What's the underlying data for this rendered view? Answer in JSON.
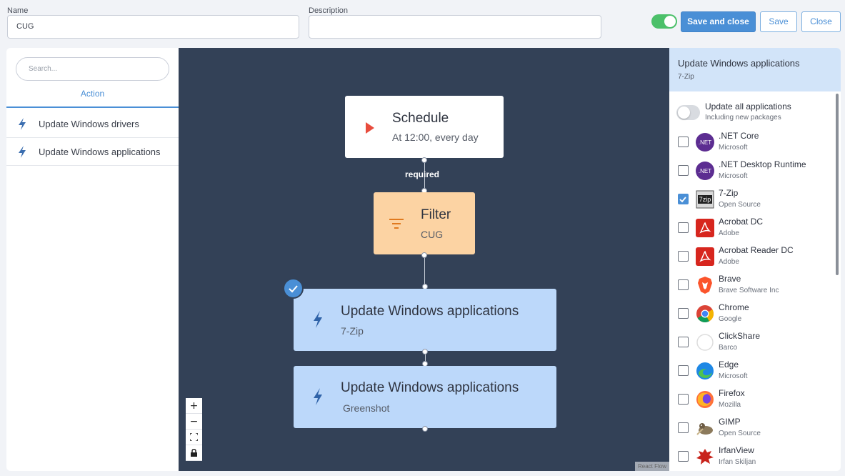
{
  "form": {
    "name_label": "Name",
    "name_value": "CUG",
    "description_label": "Description",
    "description_value": "",
    "enabled": true
  },
  "toolbar": {
    "save_and_close_label": "Save and close",
    "save_label": "Save",
    "close_label": "Close"
  },
  "left_panel": {
    "search_placeholder": "Search...",
    "tab_label": "Action",
    "actions": [
      {
        "label": "Update Windows drivers"
      },
      {
        "label": "Update Windows applications"
      }
    ]
  },
  "flow": {
    "schedule": {
      "title": "Schedule",
      "subtitle": "At 12:00, every day"
    },
    "edge_label": "required",
    "filter": {
      "title": "Filter",
      "subtitle": "CUG"
    },
    "action1": {
      "title": "Update Windows applications",
      "subtitle": "7-Zip"
    },
    "action2": {
      "title": "Update Windows applications",
      "subtitle": "Greenshot"
    },
    "zoom_in": "+",
    "zoom_out": "−",
    "attribution": "React Flow"
  },
  "right_panel": {
    "title": "Update Windows applications",
    "subtitle": "7-Zip",
    "update_all_label": "Update all applications",
    "update_all_sub": "Including new packages",
    "update_all_enabled": false,
    "apps": [
      {
        "name": ".NET Core",
        "vendor": "Microsoft",
        "checked": false,
        "icon": "dotnet-icon"
      },
      {
        "name": ".NET Desktop Runtime",
        "vendor": "Microsoft",
        "checked": false,
        "icon": "dotnet-icon"
      },
      {
        "name": "7-Zip",
        "vendor": "Open Source",
        "checked": true,
        "icon": "7zip-icon"
      },
      {
        "name": "Acrobat DC",
        "vendor": "Adobe",
        "checked": false,
        "icon": "acrobat-icon"
      },
      {
        "name": "Acrobat Reader DC",
        "vendor": "Adobe",
        "checked": false,
        "icon": "acrobat-icon"
      },
      {
        "name": "Brave",
        "vendor": "Brave Software Inc",
        "checked": false,
        "icon": "brave-icon"
      },
      {
        "name": "Chrome",
        "vendor": "Google",
        "checked": false,
        "icon": "chrome-icon"
      },
      {
        "name": "ClickShare",
        "vendor": "Barco",
        "checked": false,
        "icon": "clickshare-icon"
      },
      {
        "name": "Edge",
        "vendor": "Microsoft",
        "checked": false,
        "icon": "edge-icon"
      },
      {
        "name": "Firefox",
        "vendor": "Mozilla",
        "checked": false,
        "icon": "firefox-icon"
      },
      {
        "name": "GIMP",
        "vendor": "Open Source",
        "checked": false,
        "icon": "gimp-icon"
      },
      {
        "name": "IrfanView",
        "vendor": "Irfan Skiljan",
        "checked": false,
        "icon": "irfanview-icon"
      }
    ]
  },
  "colors": {
    "accent": "#4a8fd6",
    "canvas": "#334157",
    "filter_node": "#fcd3a3",
    "action_node": "#bcd8fa",
    "toggle_on": "#4cc06a",
    "schedule_play": "#e84c3d"
  }
}
